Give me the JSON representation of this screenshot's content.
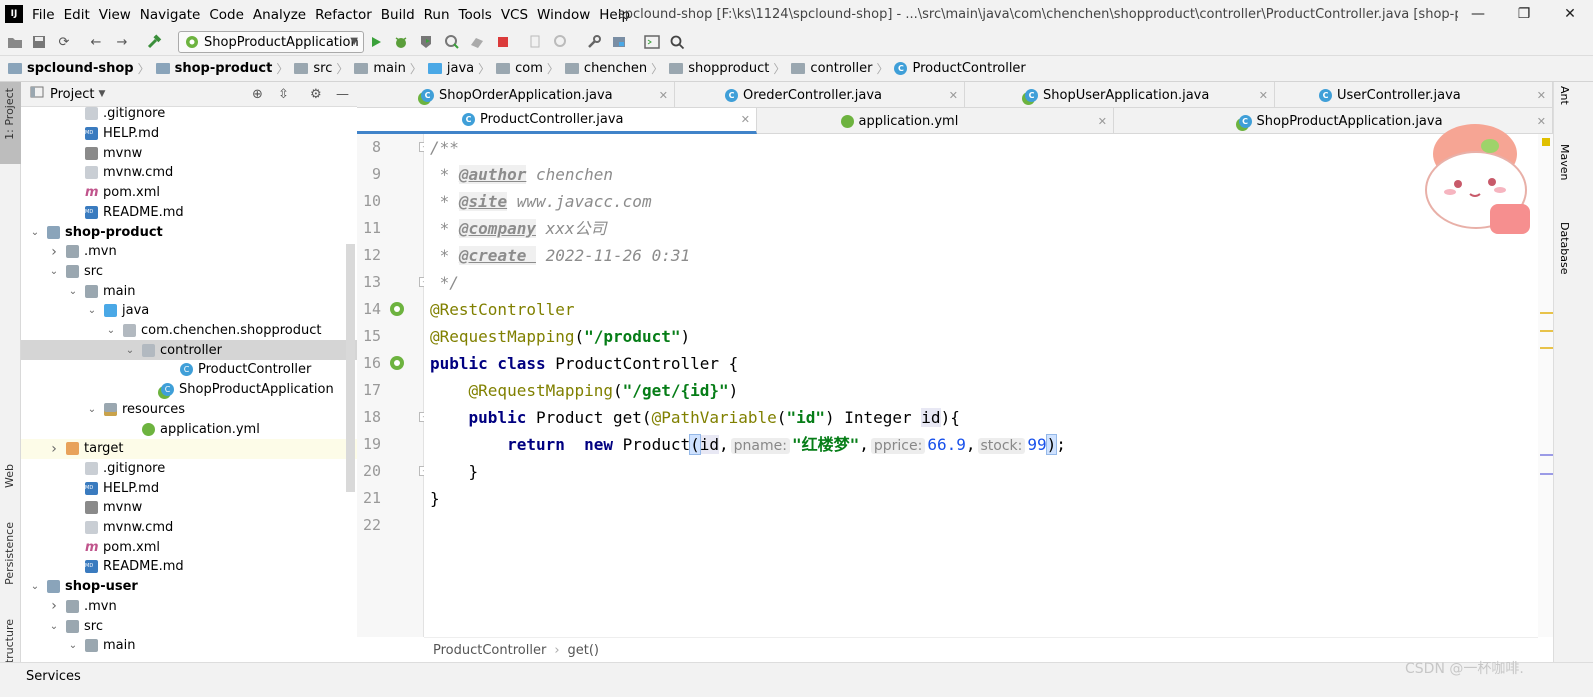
{
  "menubar": {
    "logo": "IJ",
    "menus": [
      "File",
      "Edit",
      "View",
      "Navigate",
      "Code",
      "Analyze",
      "Refactor",
      "Build",
      "Run",
      "Tools",
      "VCS",
      "Window",
      "Help"
    ],
    "title": "spclound-shop [F:\\ks\\1124\\spclound-shop] - ...\\src\\main\\java\\com\\chenchen\\shopproduct\\controller\\ProductController.java [shop-product]"
  },
  "toolbar": {
    "run_config": "ShopProductApplication"
  },
  "breadcrumb": [
    "spclound-shop",
    "shop-product",
    "src",
    "main",
    "java",
    "com",
    "chenchen",
    "shopproduct",
    "controller",
    "ProductController"
  ],
  "project_panel": {
    "title": "Project",
    "tree": [
      {
        "label": ".gitignore",
        "level": 3,
        "icon": "file-icon"
      },
      {
        "label": "HELP.md",
        "level": 3,
        "icon": "markdown-icon"
      },
      {
        "label": "mvnw",
        "level": 3,
        "icon": "script-icon"
      },
      {
        "label": "mvnw.cmd",
        "level": 3,
        "icon": "file-icon"
      },
      {
        "label": "pom.xml",
        "level": 3,
        "icon": "maven-icon"
      },
      {
        "label": "README.md",
        "level": 3,
        "icon": "markdown-icon"
      },
      {
        "label": "shop-product",
        "level": 1,
        "icon": "module-icon",
        "bold": true,
        "expanded": true
      },
      {
        "label": ".mvn",
        "level": 2,
        "icon": "folder-icon",
        "collapsed": true
      },
      {
        "label": "src",
        "level": 2,
        "icon": "folder-icon",
        "expanded": true
      },
      {
        "label": "main",
        "level": 3,
        "icon": "folder-icon",
        "expanded": true
      },
      {
        "label": "java",
        "level": 4,
        "icon": "source-folder-icon",
        "expanded": true
      },
      {
        "label": "com.chenchen.shopproduct",
        "level": 5,
        "icon": "package-icon",
        "expanded": true
      },
      {
        "label": "controller",
        "level": 6,
        "icon": "package-icon",
        "expanded": true,
        "selected": true
      },
      {
        "label": "ProductController",
        "level": 8,
        "icon": "class-icon"
      },
      {
        "label": "ShopProductApplication",
        "level": 7,
        "icon": "spring-class-icon"
      },
      {
        "label": "resources",
        "level": 4,
        "icon": "resources-folder-icon",
        "expanded": true
      },
      {
        "label": "application.yml",
        "level": 6,
        "icon": "yaml-icon"
      },
      {
        "label": "target",
        "level": 2,
        "icon": "excluded-folder-icon",
        "collapsed": true,
        "highlight": true
      },
      {
        "label": ".gitignore",
        "level": 3,
        "icon": "file-icon"
      },
      {
        "label": "HELP.md",
        "level": 3,
        "icon": "markdown-icon"
      },
      {
        "label": "mvnw",
        "level": 3,
        "icon": "script-icon"
      },
      {
        "label": "mvnw.cmd",
        "level": 3,
        "icon": "file-icon"
      },
      {
        "label": "pom.xml",
        "level": 3,
        "icon": "maven-icon"
      },
      {
        "label": "README.md",
        "level": 3,
        "icon": "markdown-icon"
      },
      {
        "label": "shop-user",
        "level": 1,
        "icon": "module-icon",
        "bold": true,
        "expanded": true
      },
      {
        "label": ".mvn",
        "level": 2,
        "icon": "folder-icon",
        "collapsed": true
      },
      {
        "label": "src",
        "level": 2,
        "icon": "folder-icon",
        "expanded": true
      },
      {
        "label": "main",
        "level": 3,
        "icon": "folder-icon",
        "expanded": true
      }
    ]
  },
  "left_strip": {
    "project": "1: Project",
    "web": "Web",
    "persistence": "Persistence",
    "structure": "Z: Structure"
  },
  "right_strip": {
    "ant": "Ant",
    "maven": "Maven",
    "database": "Database"
  },
  "editor_tabs_row1": [
    {
      "label": "ShopOrderApplication.java",
      "icon": "spring-class-icon"
    },
    {
      "label": "OrederController.java",
      "icon": "class-icon"
    },
    {
      "label": "ShopUserApplication.java",
      "icon": "spring-class-icon"
    },
    {
      "label": "UserController.java",
      "icon": "class-icon"
    }
  ],
  "editor_tabs_row2": [
    {
      "label": "ProductController.java",
      "icon": "class-icon",
      "active": true
    },
    {
      "label": "application.yml",
      "icon": "yaml-icon"
    },
    {
      "label": "ShopProductApplication.java",
      "icon": "spring-class-icon"
    }
  ],
  "code": {
    "line_numbers": [
      "8",
      "9",
      "10",
      "11",
      "12",
      "13",
      "14",
      "15",
      "16",
      "17",
      "18",
      "19",
      "20",
      "21",
      "22"
    ],
    "l8": "/**",
    "l9_tag": "@author",
    "l9_text": " chenchen",
    "l10_tag": "@site",
    "l10_text": " www.javacc.com",
    "l11_tag": "@company",
    "l11_text": " xxx公司",
    "l12_tag": "@create ",
    "l12_text": " 2022-11-26 0:31",
    "l13": " */",
    "l14": "@RestController",
    "l15_ann": "@RequestMapping",
    "l15_str": "\"/product\"",
    "l16_kw": "public class",
    "l16_rest": " ProductController {",
    "l17_ann": "@RequestMapping",
    "l17_str": "\"/get/{id}\"",
    "l18_kw": "public",
    "l18_a": " Product get(",
    "l18_ann": "@PathVariable",
    "l18_str": "\"id\"",
    "l18_b": ") Integer ",
    "l18_id": "id",
    "l18_c": "){",
    "l19_return": "return",
    "l19_new": "new",
    "l19_a": " Product",
    "l19_id": "id",
    "l19_hint1": "pname:",
    "l19_str": "\"红楼梦\"",
    "l19_hint2": "pprice:",
    "l19_num1": "66.9",
    "l19_hint3": "stock:",
    "l19_num2": "99",
    "l20": "    }",
    "l21": "}"
  },
  "editor_crumb": [
    "ProductController",
    "get()"
  ],
  "services": "Services",
  "watermark": "CSDN @一杯咖啡.",
  "colors": {
    "keyword": "#000080",
    "annotation": "#808000",
    "string": "#067d17",
    "number": "#1750eb",
    "comment": "#8c8c8c"
  }
}
